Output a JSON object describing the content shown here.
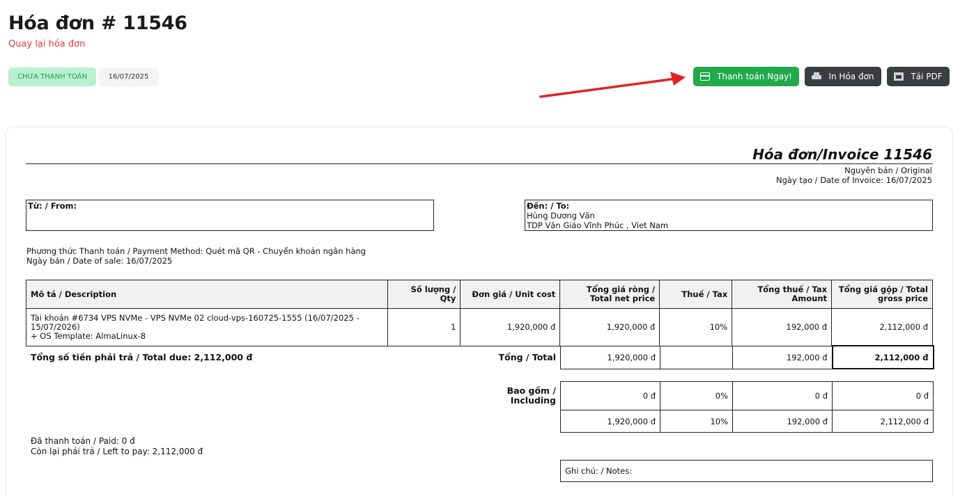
{
  "header": {
    "title": "Hóa đơn # 11546",
    "back_link": "Quay lại hóa đơn",
    "status": "CHƯA THANH TOÁN",
    "date": "16/07/2025"
  },
  "actions": {
    "pay_label": "Thanh toán Ngay!",
    "print_label": "In Hóa đơn",
    "pdf_label": "Tải PDF"
  },
  "colors": {
    "pay_button": "#22a94c",
    "dark_button": "#3a3d40",
    "status_bg": "#b9f0cf",
    "status_text": "#1d9d4d",
    "link": "#e03a3a",
    "arrow": "#e02424"
  },
  "invoice": {
    "title": "Hóa đơn/Invoice 11546",
    "original": "Nguyên bản / Original",
    "date_of_invoice": "Ngày tạo / Date of Invoice: 16/07/2025",
    "from_label": "Từ: / From:",
    "to_label": "Đến: / To:",
    "to_name": "Hùng Dương Văn",
    "to_address": "TDP Văn Giáo Vĩnh Phúc , Viet Nam",
    "payment_method": "Phương thức Thanh toán / Payment Method: Quét mã QR - Chuyển khoản ngân hàng",
    "date_of_sale": "Ngày bán / Date of sale: 16/07/2025",
    "columns": {
      "description": "Mô tả / Description",
      "qty": "Số lượng / Qty",
      "unit_cost": "Đơn giá / Unit cost",
      "net": "Tổng giá ròng / Total net price",
      "tax": "Thuế / Tax",
      "tax_amount": "Tổng thuế / Tax Amount",
      "gross": "Tổng giá gộp / Total gross price"
    },
    "item": {
      "description_1": "Tài khoản #6734 VPS NVMe - VPS NVMe 02 cloud-vps-160725-1555 (16/07/2025 - 15/07/2026)",
      "description_2": "+ OS Template: AlmaLinux-8",
      "qty": "1",
      "unit_cost": "1,920,000 đ",
      "net": "1,920,000 đ",
      "tax": "10%",
      "tax_amount": "192,000 đ",
      "gross": "2,112,000 đ"
    },
    "total_due": "Tổng số tiền phải trả / Total due: 2,112,000 đ",
    "total_label": "Tổng / Total",
    "total": {
      "net": "1,920,000 đ",
      "tax": "",
      "tax_amount": "192,000 đ",
      "gross": "2,112,000 đ"
    },
    "including_label": "Bao gồm / Including",
    "including": [
      {
        "net": "0 đ",
        "tax": "0%",
        "tax_amount": "0 đ",
        "gross": "0 đ"
      },
      {
        "net": "1,920,000 đ",
        "tax": "10%",
        "tax_amount": "192,000 đ",
        "gross": "2,112,000 đ"
      }
    ],
    "paid": "Đã thanh toán / Paid: 0 đ",
    "left_to_pay": "Còn lại phải trả / Left to pay: 2,112,000 đ",
    "notes_label": "Ghi chú: / Notes:"
  }
}
